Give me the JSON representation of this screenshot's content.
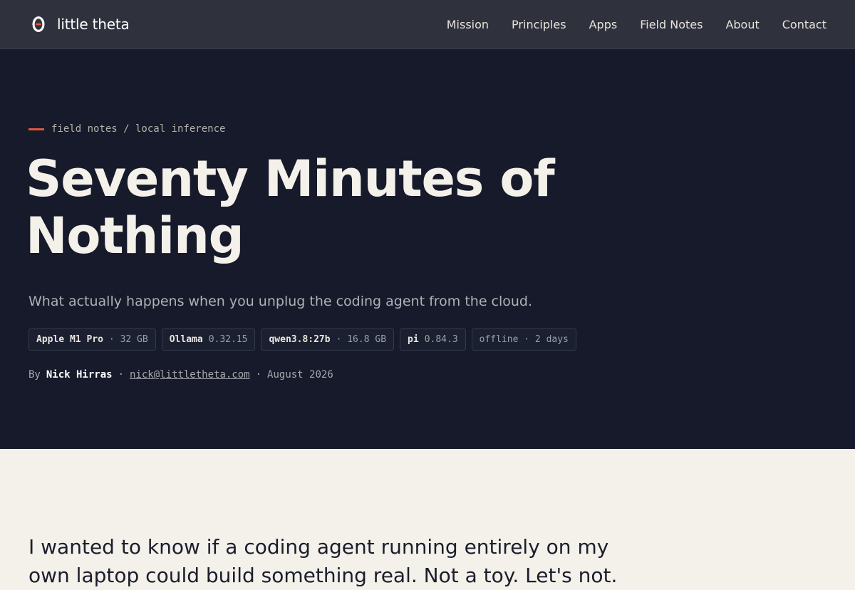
{
  "nav": {
    "brand": "little theta",
    "links": [
      "Mission",
      "Principles",
      "Apps",
      "Field Notes",
      "About",
      "Contact"
    ]
  },
  "hero": {
    "eyebrow": "field notes / local inference",
    "title": "Seventy Minutes of Nothing",
    "subtitle": "What actually happens when you unplug the coding agent from the cloud.",
    "chips": [
      {
        "key": "Apple M1 Pro",
        "value": "· 32 GB"
      },
      {
        "key": "Ollama",
        "value": "0.32.15"
      },
      {
        "key": "qwen3.8:27b",
        "value": "· 16.8 GB"
      },
      {
        "key": "pi",
        "value": "0.84.3"
      },
      {
        "key": "",
        "value": "offline · 2 days"
      }
    ],
    "byline": {
      "prefix": "By",
      "author": "Nick Hirras",
      "sep1": "·",
      "email": "nick@littletheta.com",
      "sep2": "·",
      "date": "August 2026"
    }
  },
  "article": {
    "lead": "I wanted to know if a coding agent running entirely on my own laptop could build something real. Not a toy. Let's not."
  },
  "colors": {
    "accent": "#e0573a",
    "hero_bg": "#161a2a",
    "nav_bg": "#2f323d",
    "page_bg": "#f4f1eb"
  }
}
